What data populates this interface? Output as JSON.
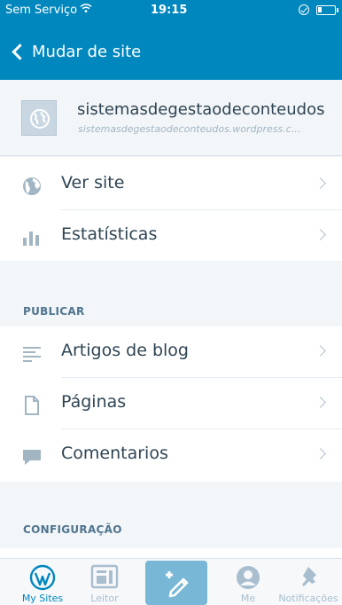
{
  "status_bar": {
    "carrier": "Sem Serviço",
    "wifi_icon": "wifi-icon",
    "time": "19:15",
    "lock_icon": "orientation-lock-icon",
    "battery_icon": "battery-icon"
  },
  "nav": {
    "back_label": "Mudar de site",
    "back_icon": "chevron-left-icon"
  },
  "site": {
    "name": "sistemasdegestaodeconteudos",
    "url": "sistemasdegestaodeconteudos.wordpress.c...",
    "icon": "globe-icon"
  },
  "menu_top": [
    {
      "label": "Ver site",
      "icon": "globe-icon"
    },
    {
      "label": "Estatísticas",
      "icon": "stats-icon"
    }
  ],
  "sections": {
    "publish_header": "PUBLICAR",
    "config_header": "CONFIGURAÇÃO"
  },
  "menu_publish": [
    {
      "label": "Artigos de blog",
      "icon": "posts-icon"
    },
    {
      "label": "Páginas",
      "icon": "page-icon"
    },
    {
      "label": "Comentarios",
      "icon": "comment-icon"
    }
  ],
  "tabs": [
    {
      "label": "My Sites",
      "icon": "wordpress-icon",
      "active": true
    },
    {
      "label": "Leitor",
      "icon": "reader-icon",
      "active": false
    },
    {
      "label": "",
      "icon": "write-icon",
      "active": false
    },
    {
      "label": "Me",
      "icon": "user-icon",
      "active": false
    },
    {
      "label": "Notificações",
      "icon": "notifications-icon",
      "active": false
    }
  ],
  "colors": {
    "brand_blue": "#0087be",
    "text_dark": "#2e4453",
    "icon_gray": "#a1b5c3",
    "section_header": "#4f748e"
  }
}
